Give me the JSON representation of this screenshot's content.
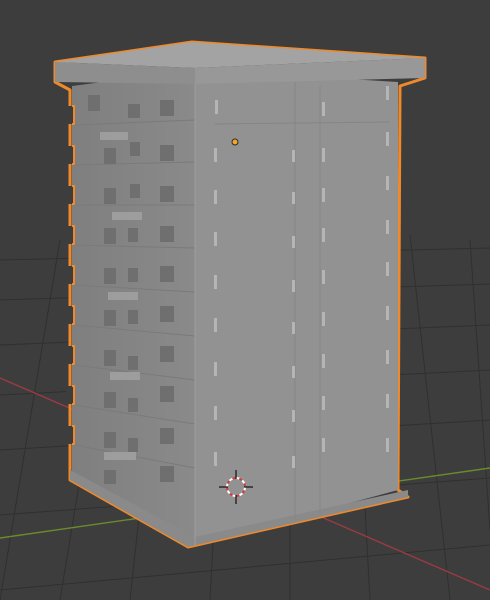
{
  "viewport": {
    "editor": "3D Viewport",
    "background_color": "#3d3d3d",
    "grid_color": "#2f2f2f",
    "x_axis_color": "#9c3a44",
    "y_axis_color": "#6a8a2c"
  },
  "scene": {
    "selected_object": "building",
    "object_shading": "solid",
    "selection_outline_color": "#f0892a",
    "origin_color": "#f5a623",
    "surface_color": "#8f8f8f"
  },
  "icons": {
    "cursor": "3d-cursor-icon",
    "origin": "object-origin-icon"
  }
}
